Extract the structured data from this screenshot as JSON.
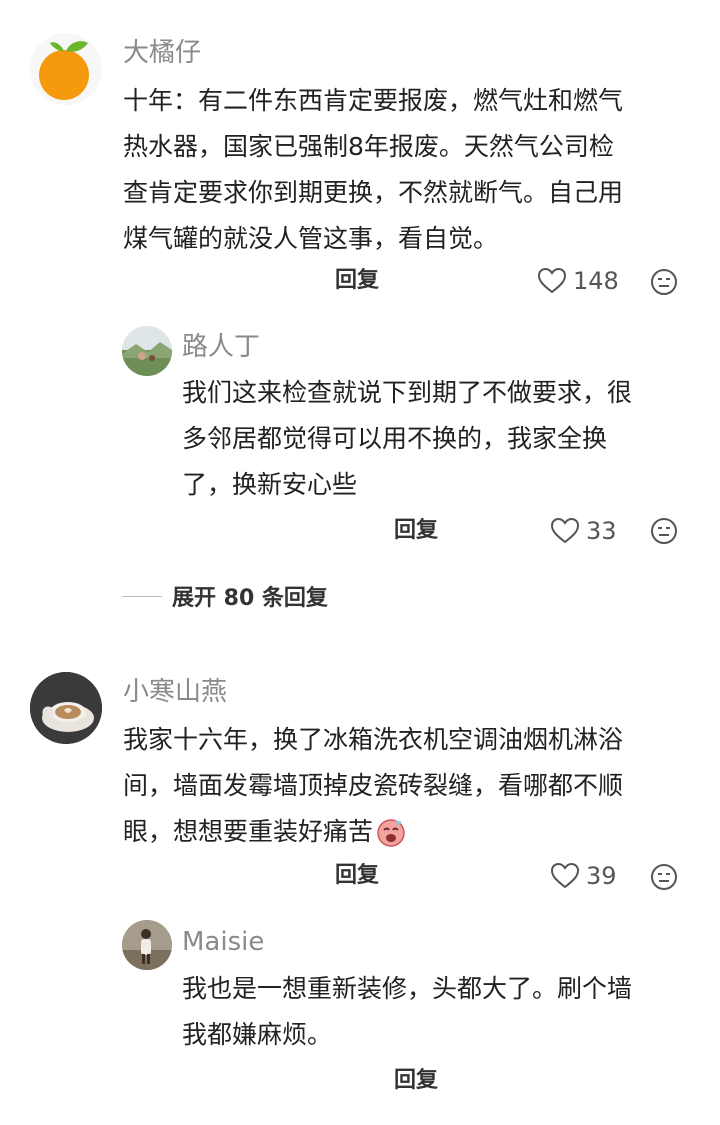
{
  "colors": {
    "orange_avatar": "#F59A0C",
    "leaf": "#6CB52D",
    "muted": "#8a8a8a",
    "text": "#222222"
  },
  "comments": [
    {
      "author": "大橘仔",
      "text_lines": [
        "十年：有二件东西肯定要报废，燃气灶和燃气",
        "热水器，国家已强制8年报废。天然气公司检",
        "查肯定要求你到期更换，不然就断气。自己用",
        "煤气罐的就没人管这事，看自觉。"
      ],
      "reply_label": "回复",
      "likes": "148",
      "reply": {
        "author": "路人丁",
        "text_lines": [
          "我们这来检查就说下到期了不做要求，很",
          "多邻居都觉得可以用不换的，我家全换",
          "了，换新安心些"
        ],
        "reply_label": "回复",
        "likes": "33"
      },
      "expand_label": "展开 80 条回复"
    },
    {
      "author": "小寒山燕",
      "text_lines": [
        "我家十六年，换了冰箱洗衣机空调油烟机淋浴",
        "间，墙面发霉墙顶掉皮瓷砖裂缝，看哪都不顺",
        "眼，想想要重装好痛苦"
      ],
      "reply_label": "回复",
      "likes": "39",
      "reply": {
        "author": "Maisie",
        "text_lines": [
          "我也是一想重新装修，头都大了。刷个墙",
          "我都嫌麻烦。"
        ],
        "reply_label": "回复"
      }
    }
  ]
}
